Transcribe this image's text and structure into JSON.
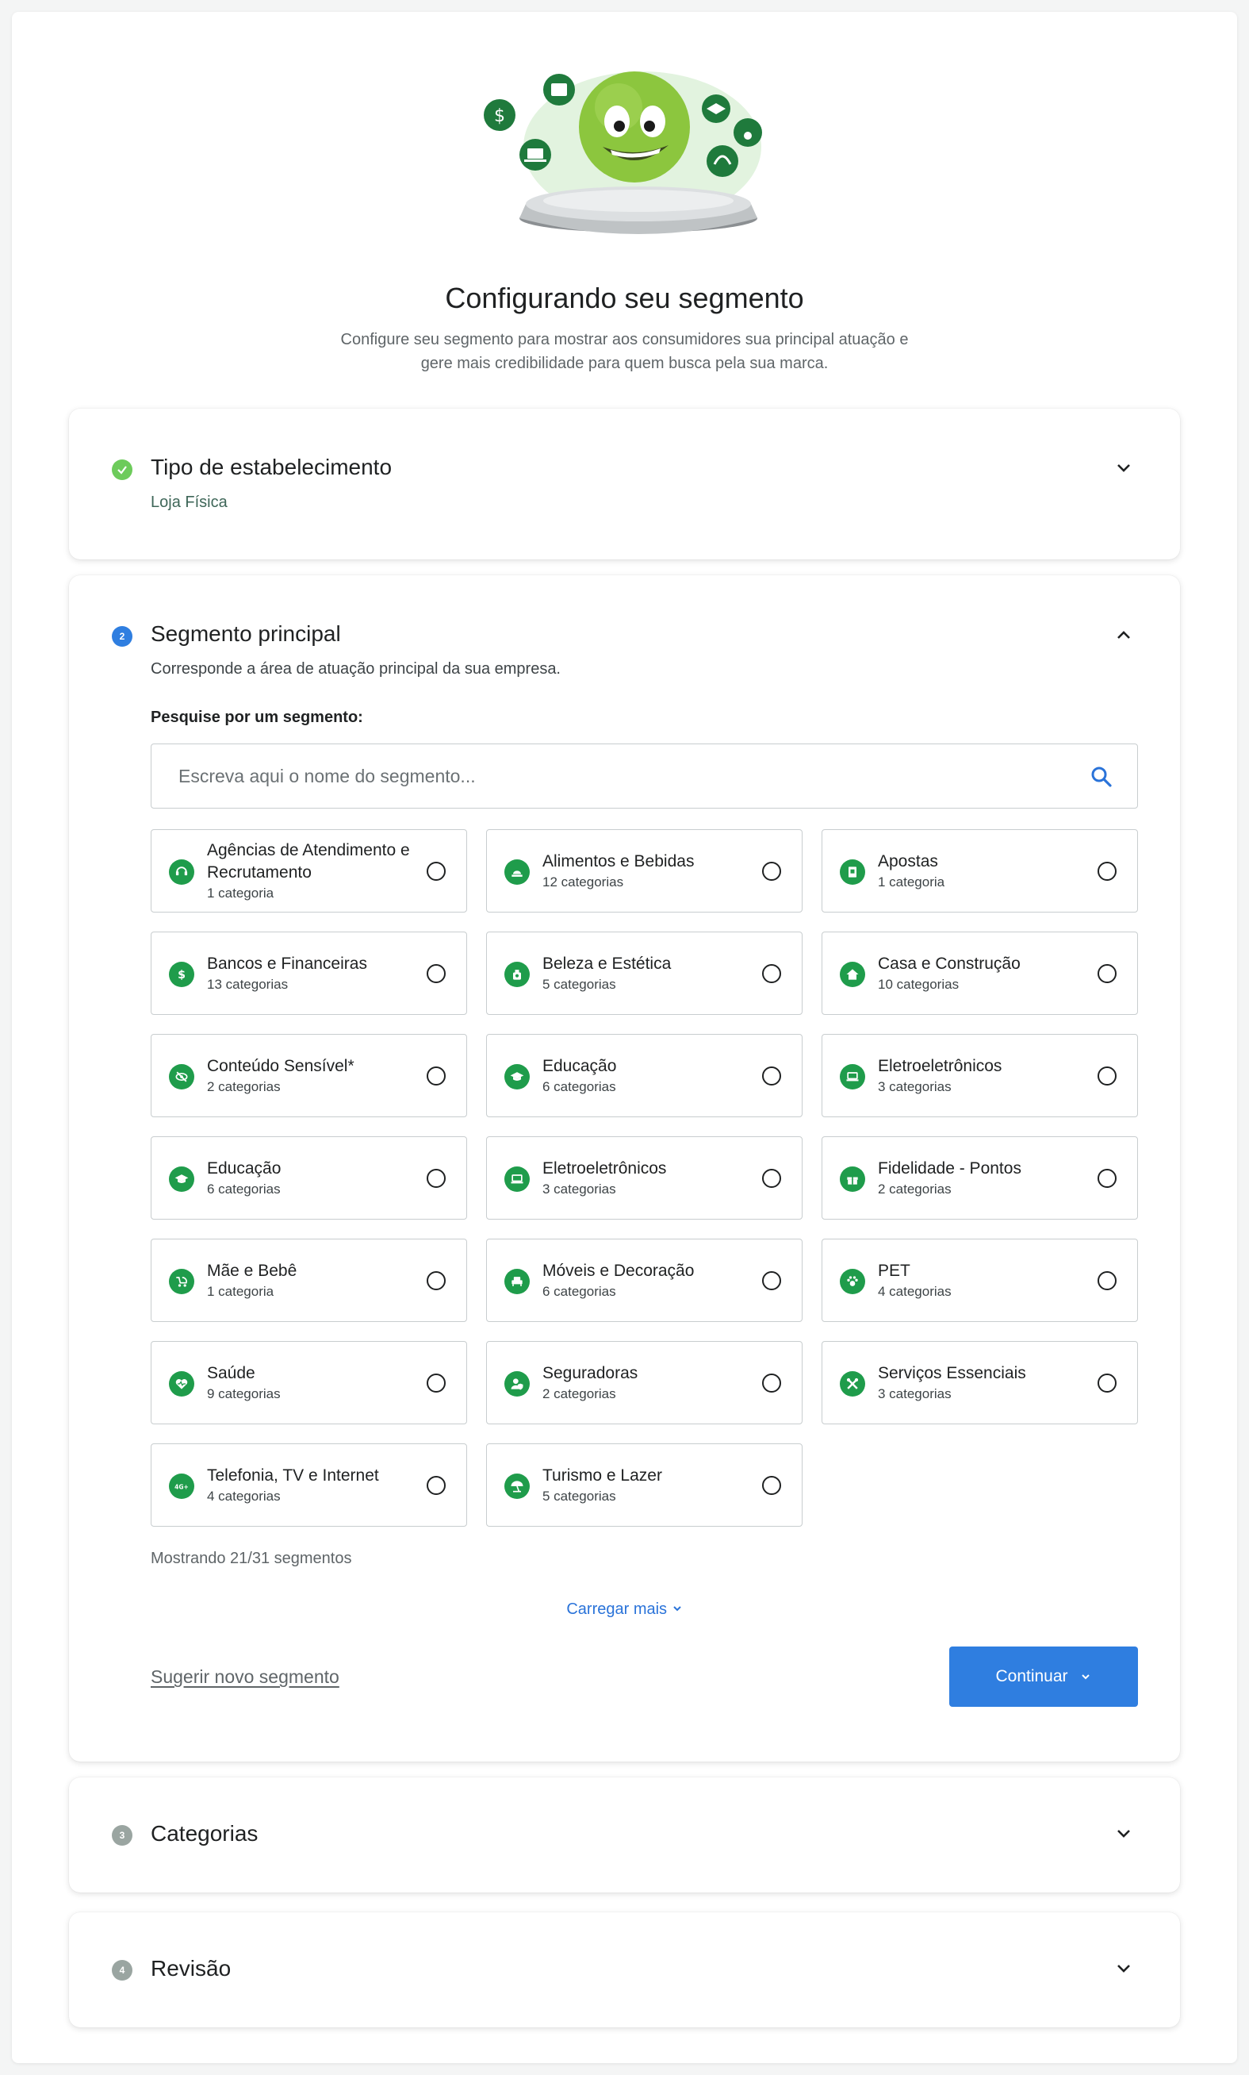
{
  "header": {
    "title": "Configurando seu segmento",
    "subtitle": "Configure seu segmento para mostrar aos consumidores sua principal atuação e gere mais credibilidade para quem busca pela sua marca."
  },
  "colors": {
    "brand_green": "#1f9c4b",
    "mascot_green": "#8cc63e",
    "primary_blue": "#2f7ee0",
    "success_green": "#6dcb5b",
    "step_blue": "#2f7ee0",
    "step_grey": "#9aa5a1"
  },
  "steps": [
    {
      "number": "✓",
      "title": "Tipo de estabelecimento",
      "value": "Loja Física",
      "state": "completed"
    },
    {
      "number": "2",
      "title": "Segmento principal",
      "description": "Corresponde a área de atuação principal da sua empresa.",
      "state": "active"
    },
    {
      "number": "3",
      "title": "Categorias",
      "state": "pending"
    },
    {
      "number": "4",
      "title": "Revisão",
      "state": "pending"
    }
  ],
  "search": {
    "label": "Pesquise por um segmento:",
    "value": "",
    "placeholder": "Escreva aqui o nome do segmento..."
  },
  "segments": [
    {
      "name": "Agências de Atendimento e Recrutamento",
      "count": "1 categoria",
      "icon": "headset-icon"
    },
    {
      "name": "Alimentos e Bebidas",
      "count": "12 categorias",
      "icon": "food-icon"
    },
    {
      "name": "Apostas",
      "count": "1 categoria",
      "icon": "ticket-icon"
    },
    {
      "name": "Bancos e Financeiras",
      "count": "13 categorias",
      "icon": "dollar-icon"
    },
    {
      "name": "Beleza e Estética",
      "count": "5 categorias",
      "icon": "perfume-icon"
    },
    {
      "name": "Casa e Construção",
      "count": "10 categorias",
      "icon": "house-icon"
    },
    {
      "name": "Conteúdo Sensível*",
      "count": "2 categorias",
      "icon": "eye-off-icon"
    },
    {
      "name": "Educação",
      "count": "6 categorias",
      "icon": "graduation-cap-icon"
    },
    {
      "name": "Eletroeletrônicos",
      "count": "3 categorias",
      "icon": "laptop-icon"
    },
    {
      "name": "Educação",
      "count": "6 categorias",
      "icon": "graduation-cap-icon"
    },
    {
      "name": "Eletroeletrônicos",
      "count": "3 categorias",
      "icon": "laptop-icon"
    },
    {
      "name": "Fidelidade - Pontos",
      "count": "2 categorias",
      "icon": "gift-icon"
    },
    {
      "name": "Mãe e Bebê",
      "count": "1 categoria",
      "icon": "stroller-icon"
    },
    {
      "name": "Móveis e Decoração",
      "count": "6 categorias",
      "icon": "armchair-icon"
    },
    {
      "name": "PET",
      "count": "4 categorias",
      "icon": "paw-icon"
    },
    {
      "name": "Saúde",
      "count": "9 categorias",
      "icon": "heart-pulse-icon"
    },
    {
      "name": "Seguradoras",
      "count": "2 categorias",
      "icon": "user-shield-icon"
    },
    {
      "name": "Serviços Essenciais",
      "count": "3 categorias",
      "icon": "tools-icon"
    },
    {
      "name": "Telefonia, TV e Internet",
      "count": "4 categorias",
      "icon": "4g-icon"
    },
    {
      "name": "Turismo e Lazer",
      "count": "5 categorias",
      "icon": "beach-umbrella-icon"
    }
  ],
  "pagination": {
    "showing_text": "Mostrando 21/31 segmentos",
    "load_more_label": "Carregar mais"
  },
  "actions": {
    "suggest_label": "Sugerir novo segmento",
    "continue_label": "Continuar"
  }
}
